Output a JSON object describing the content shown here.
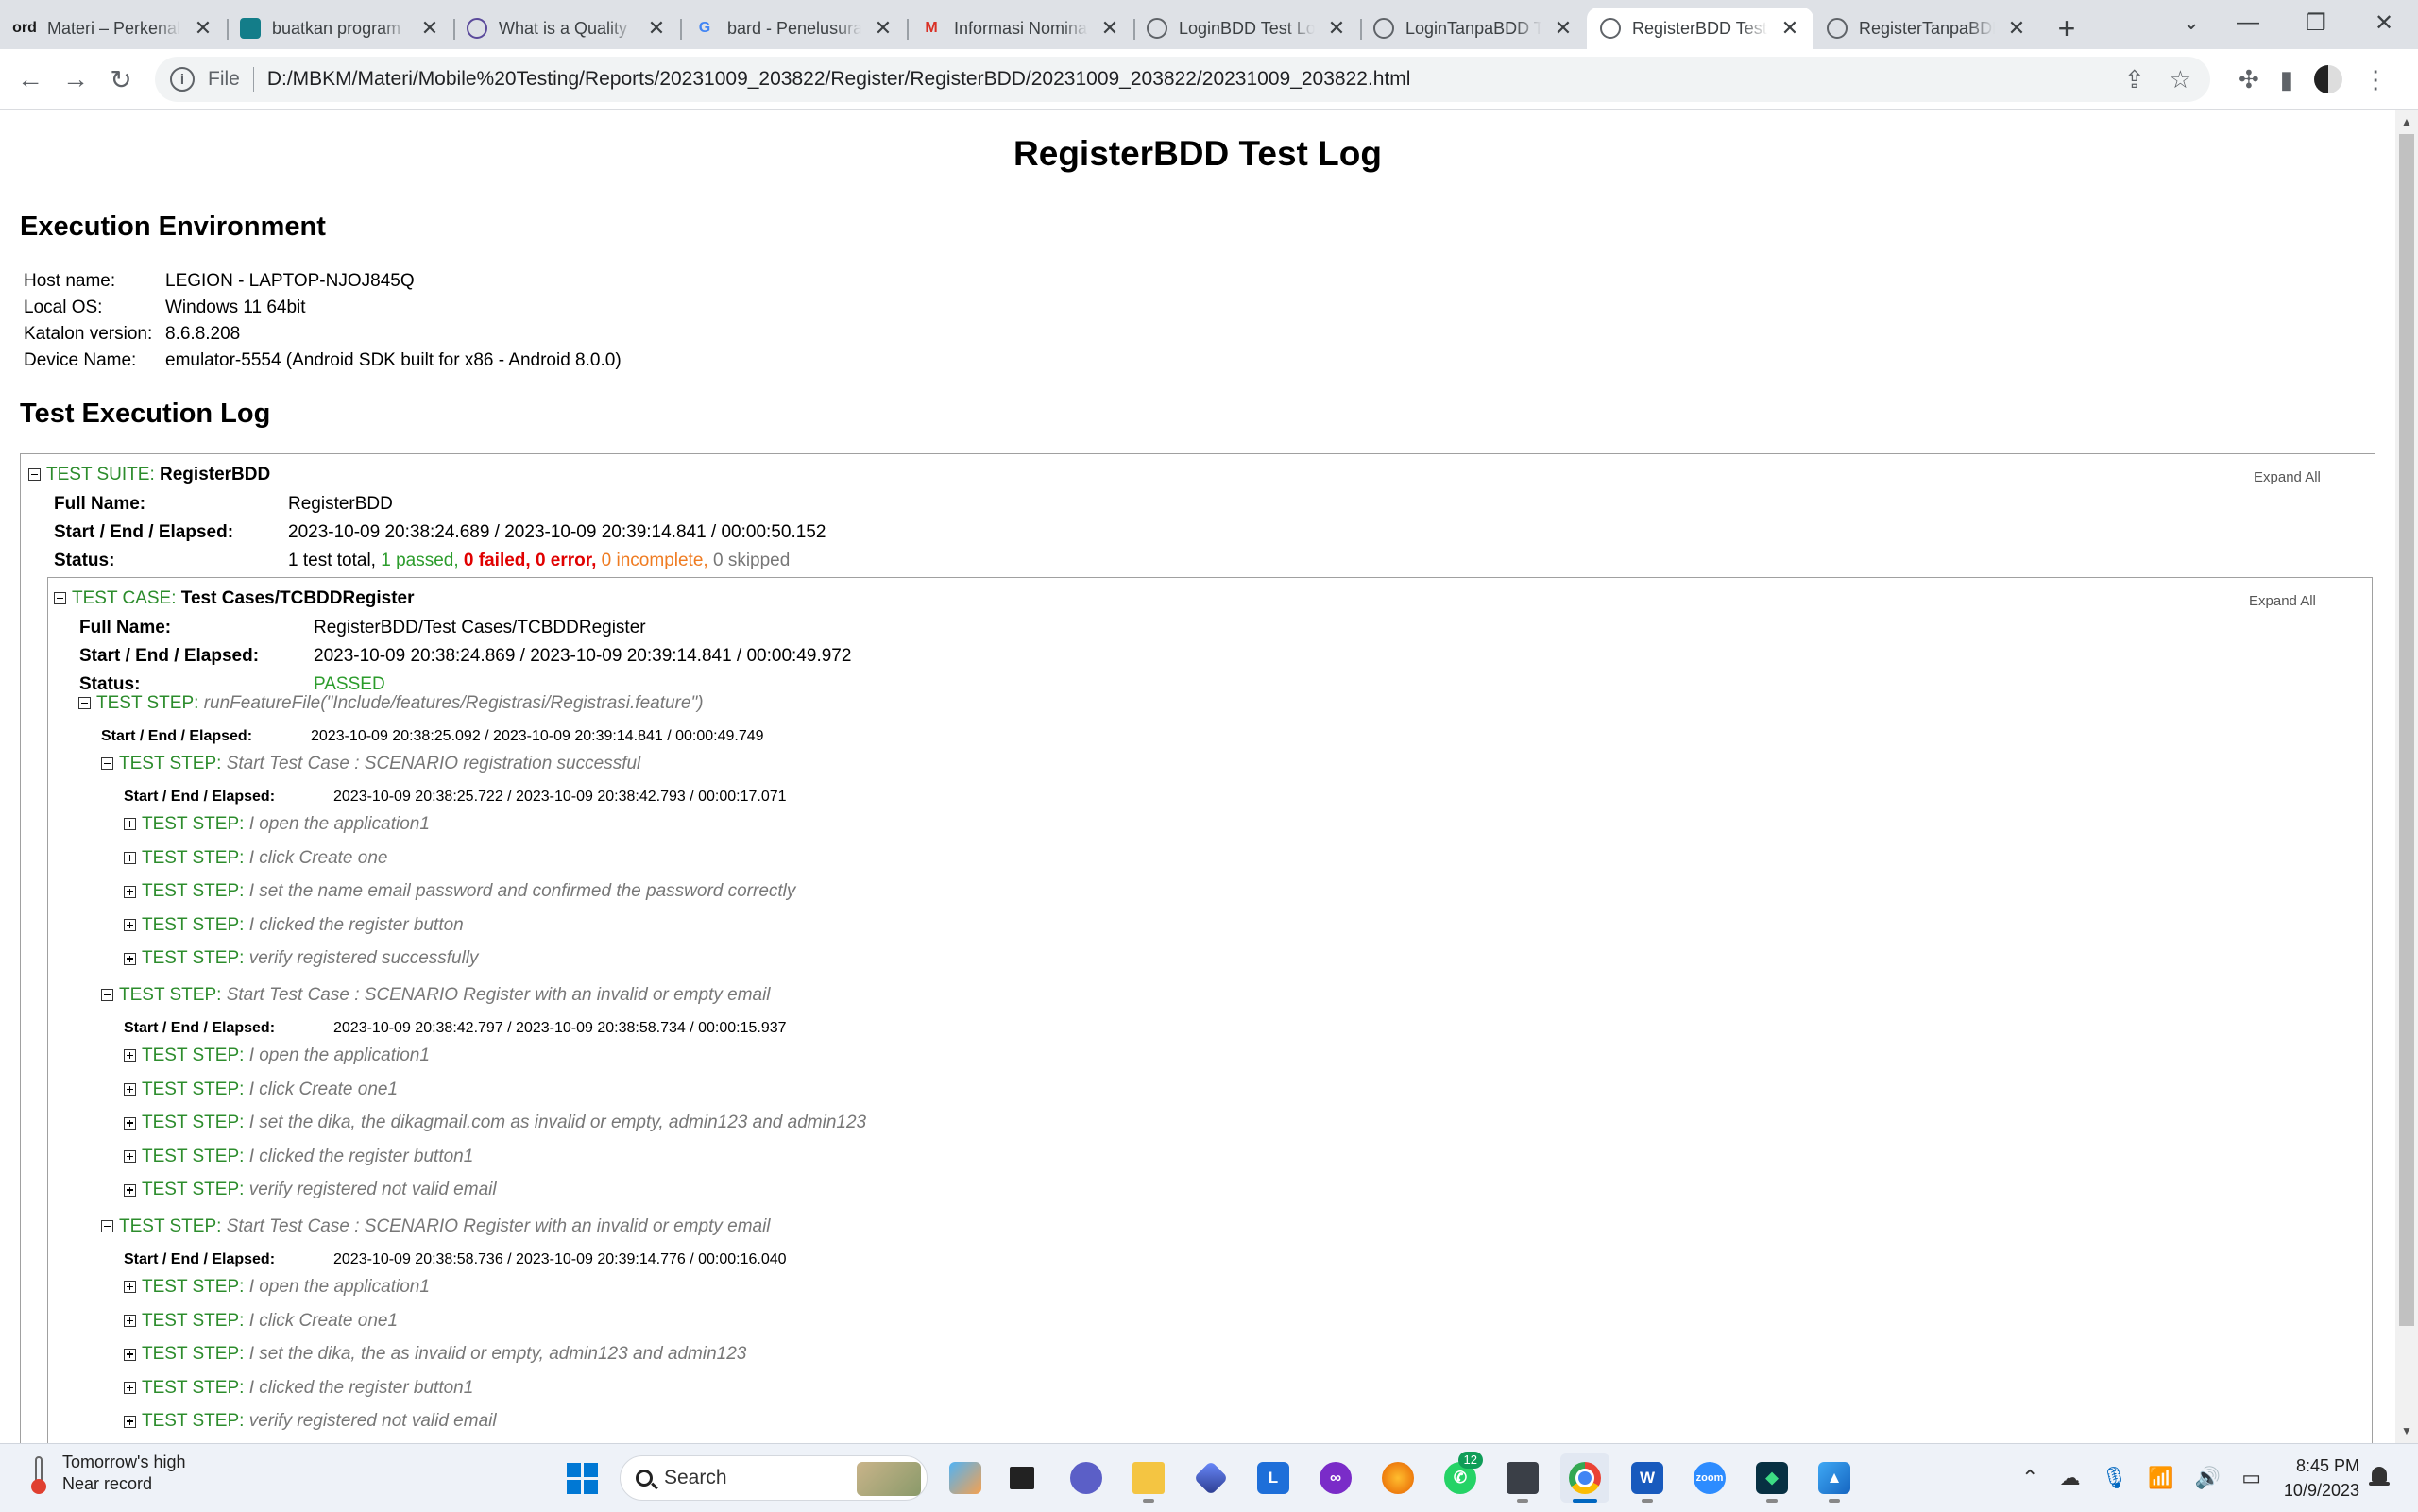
{
  "browser": {
    "tabs": [
      {
        "title": "Materi – Perkenalan",
        "favicon": "ord-icon",
        "glyph": "ord",
        "color": "#1a1a1a"
      },
      {
        "title": "buatkan program",
        "favicon": "teal-app-icon",
        "glyph": "",
        "color": "#137d89"
      },
      {
        "title": "What is a Quality",
        "favicon": "eye-icon",
        "glyph": "",
        "color": "#5b4a9b"
      },
      {
        "title": "bard - Penelusuran",
        "favicon": "google-icon",
        "glyph": "G",
        "color": "#4285f4"
      },
      {
        "title": "Informasi Nominasi",
        "favicon": "gmail-icon",
        "glyph": "M",
        "color": "#d93025"
      },
      {
        "title": "LoginBDD Test Log",
        "favicon": "globe-icon",
        "glyph": "",
        "color": "#5f6368"
      },
      {
        "title": "LoginTanpaBDD Test",
        "favicon": "globe-icon",
        "glyph": "",
        "color": "#5f6368"
      },
      {
        "title": "RegisterBDD Test Log",
        "favicon": "globe-icon",
        "glyph": "",
        "color": "#5f6368",
        "active": true
      },
      {
        "title": "RegisterTanpaBDD",
        "favicon": "globe-icon",
        "glyph": "",
        "color": "#5f6368"
      }
    ],
    "address": {
      "scheme": "File",
      "url": "D:/MBKM/Materi/Mobile%20Testing/Reports/20231009_203822/Register/RegisterBDD/20231009_203822/20231009_203822.html"
    }
  },
  "report": {
    "title": "RegisterBDD Test Log",
    "env_heading": "Execution Environment",
    "env": [
      {
        "key": "Host name:",
        "value": "LEGION - LAPTOP-NJOJ845Q"
      },
      {
        "key": "Local OS:",
        "value": "Windows 11 64bit"
      },
      {
        "key": "Katalon version:",
        "value": "8.6.8.208"
      },
      {
        "key": "Device Name:",
        "value": "emulator-5554 (Android SDK built for x86 - Android 8.0.0)"
      }
    ],
    "log_heading": "Test Execution Log",
    "suite": {
      "label": "TEST SUITE:",
      "name": "RegisterBDD",
      "expand_all": "Expand All",
      "full_name_label": "Full Name:",
      "full_name": "RegisterBDD",
      "time_label": "Start / End / Elapsed:",
      "time": "2023-10-09 20:38:24.689 / 2023-10-09 20:39:14.841 / 00:00:50.152",
      "status_label": "Status:",
      "status": {
        "total": "1 test total,",
        "passed": "1 passed,",
        "failed": "0 failed,",
        "error": "0 error,",
        "incomplete": "0 incomplete,",
        "skipped": "0 skipped"
      }
    },
    "case": {
      "label": "TEST CASE:",
      "name": "Test Cases/TCBDDRegister",
      "expand_all": "Expand All",
      "full_name_label": "Full Name:",
      "full_name": "RegisterBDD/Test Cases/TCBDDRegister",
      "time_label": "Start / End / Elapsed:",
      "time": "2023-10-09 20:38:24.869 / 2023-10-09 20:39:14.841 / 00:00:49.972",
      "status_label": "Status:",
      "status": "PASSED"
    },
    "step_label": "TEST STEP:",
    "time_label": "Start / End / Elapsed:",
    "feature_step": {
      "text": "runFeatureFile(\"Include/features/Registrasi/Registrasi.feature\")",
      "time": "2023-10-09 20:38:25.092 / 2023-10-09 20:39:14.841 / 00:00:49.749"
    },
    "scenarios": [
      {
        "text": "Start Test Case : SCENARIO registration successful",
        "time": "2023-10-09 20:38:25.722 / 2023-10-09 20:38:42.793 / 00:00:17.071",
        "steps": [
          "I open the application1",
          "I click Create one",
          "I set the name email password and confirmed the password correctly",
          "I clicked the register button",
          "verify registered successfully"
        ]
      },
      {
        "text": "Start Test Case : SCENARIO Register with an invalid or empty email",
        "time": "2023-10-09 20:38:42.797 / 2023-10-09 20:38:58.734 / 00:00:15.937",
        "steps": [
          "I open the application1",
          "I click Create one1",
          "I set the dika, the dikagmail.com as invalid or empty, admin123 and admin123",
          "I clicked the register button1",
          "verify registered not valid email"
        ]
      },
      {
        "text": "Start Test Case : SCENARIO Register with an invalid or empty email",
        "time": "2023-10-09 20:38:58.736 / 2023-10-09 20:39:14.776 / 00:00:16.040",
        "steps": [
          "I open the application1",
          "I click Create one1",
          "I set the dika, the as invalid or empty, admin123 and admin123",
          "I clicked the register button1",
          "verify registered not valid email"
        ]
      }
    ]
  },
  "taskbar": {
    "weather_line1": "Tomorrow's high",
    "weather_line2": "Near record",
    "search_placeholder": "Search",
    "whatsapp_badge": "12",
    "time": "8:45 PM",
    "date": "10/9/2023"
  }
}
